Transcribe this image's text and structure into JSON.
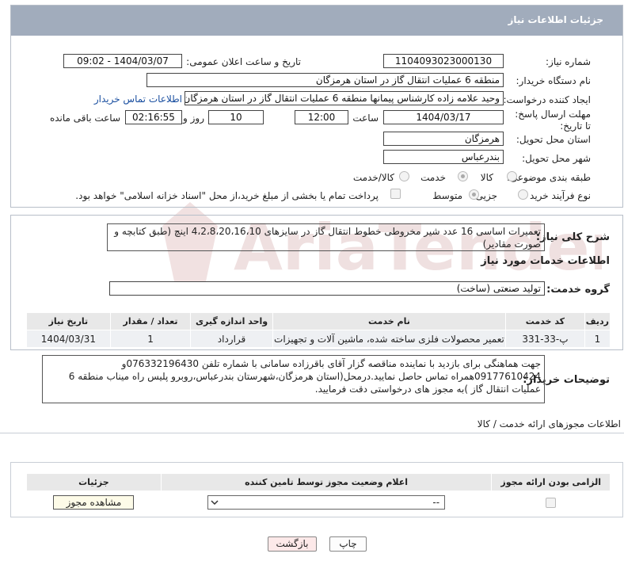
{
  "header": {
    "title": "جزئیات اطلاعات نیاز"
  },
  "fields": {
    "need_number_label": "شماره نیاز:",
    "need_number": "1104093023000130",
    "announce_label": "تاریخ و ساعت اعلان عمومی:",
    "announce_value": "1404/03/07 - 09:02",
    "buyer_org_label": "نام دستگاه خریدار:",
    "buyer_org": "منطقه 6 عملیات انتقال گاز در استان هرمزگان",
    "creator_label": "ایجاد کننده درخواست:",
    "creator": "وحید علامه زاده کارشناس پیمانها منطقه 6 عملیات انتقال گاز در استان هرمزگان",
    "contact_link": "اطلاعات تماس خریدار",
    "deadline_label": "مهلت ارسال پاسخ: تا تاریخ:",
    "deadline_date": "1404/03/17",
    "time_label": "ساعت",
    "deadline_time": "12:00",
    "days_value": "10",
    "days_label": "روز و",
    "remaining_value": "02:16:55",
    "remaining_label": "ساعت باقی مانده",
    "province_label": "استان محل تحویل:",
    "province": "هرمزگان",
    "city_label": "شهر محل تحویل:",
    "city": "بندرعباس",
    "category_label": "طبقه بندی موضوعی:",
    "category_options": [
      "کالا",
      "خدمت",
      "کالا/خدمت"
    ],
    "category_selected": "خدمت",
    "process_label": "نوع فرآیند خرید :",
    "process_options": [
      "جزیی",
      "متوسط"
    ],
    "process_selected": "متوسط",
    "payment_note": "پرداخت تمام یا بخشی از مبلغ خرید،از محل \"اسناد خزانه اسلامی\" خواهد بود."
  },
  "summary": {
    "label": "شرح کلی نیاز:",
    "text": "تعمیرات اساسی 16 عدد شیر مخروطی خطوط انتقال گاز در سایزهای 4،2،8،20،16،10 اینچ (طبق کتابچه و صورت مقادیر)"
  },
  "services": {
    "section_title": "اطلاعات خدمات مورد نیاز",
    "group_label": "گروه خدمت:",
    "group_value": "تولید صنعتی (ساخت)",
    "columns": [
      "ردیف",
      "کد خدمت",
      "نام خدمت",
      "واحد اندازه گیری",
      "تعداد / مقدار",
      "تاریخ نیاز"
    ],
    "rows": [
      {
        "row": "1",
        "code": "پ-33-331",
        "name": "تعمیر محصولات فلزی ساخته شده، ماشین آلات و تجهیزات",
        "unit": "قرارداد",
        "qty": "1",
        "date": "1404/03/31"
      }
    ]
  },
  "buyer_notes": {
    "label": "توضیحات خریدار:",
    "text": "جهت هماهنگی برای بازدید با نماینده  مناقصه گزار آقای باقرزاده سامانی با شماره تلفن 076332196430و 09177610424همراه  تماس حاصل نمایید.درمحل(استان هرمزگان،شهرستان بندرعباس،روبرو پلیس راه میناب منطقه 6 عملیات انتقال گاز )به مجوز های درخواستی دقت فرمایید."
  },
  "permits": {
    "section_title": "اطلاعات مجوزهای ارائه خدمت / کالا",
    "columns": [
      "الزامی بودن ارائه مجوز",
      "اعلام وضعیت مجوز توسط تامین کننده",
      "جزئیات"
    ],
    "select_value": "--",
    "view_button": "مشاهده مجوز"
  },
  "buttons": {
    "print": "چاپ",
    "back": "بازگشت"
  },
  "watermark": {
    "text": "AriaTender.neT"
  },
  "colors": {
    "header_bg": "#a1acbc",
    "table_header": "#e8e8e8",
    "table_row": "#eef0f3",
    "back_button_bg": "#fde9e9"
  }
}
